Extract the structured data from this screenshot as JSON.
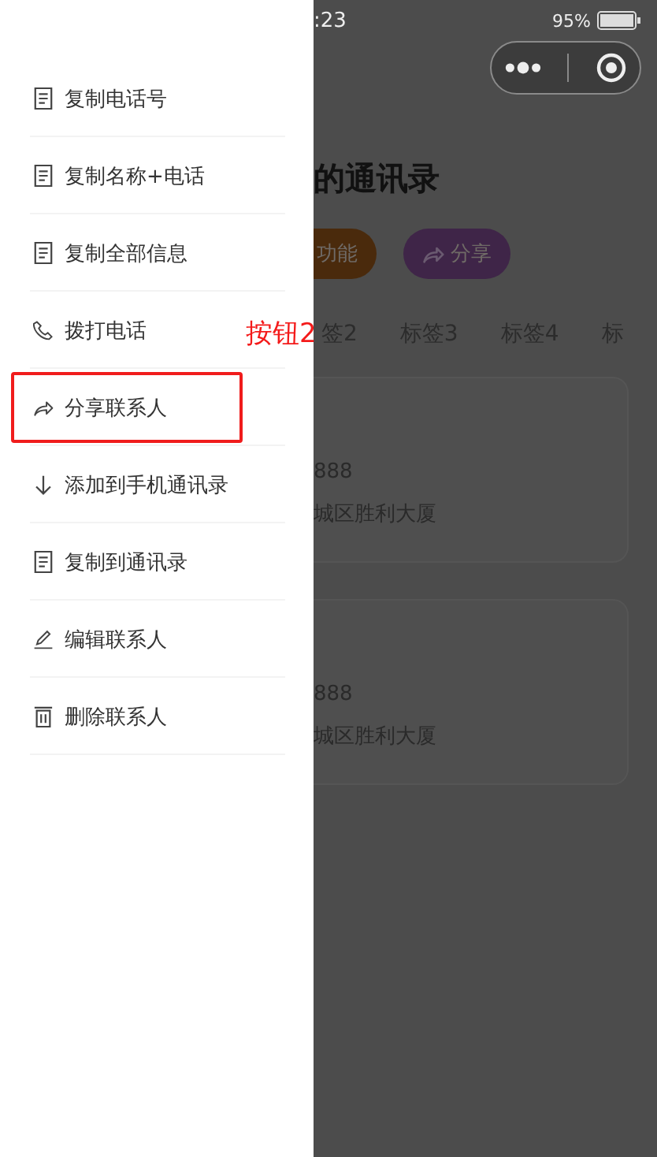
{
  "menu": {
    "items": [
      {
        "kind": "copy",
        "label": "复制电话号",
        "highlighted": false
      },
      {
        "kind": "copy",
        "label": "复制名称+电话",
        "highlighted": false
      },
      {
        "kind": "copy",
        "label": "复制全部信息",
        "highlighted": false
      },
      {
        "kind": "call",
        "label": "拨打电话",
        "highlighted": false
      },
      {
        "kind": "share",
        "label": "分享联系人",
        "highlighted": true
      },
      {
        "kind": "add",
        "label": "添加到手机通讯录",
        "highlighted": false
      },
      {
        "kind": "copy",
        "label": "复制到通讯录",
        "highlighted": false
      },
      {
        "kind": "edit",
        "label": "编辑联系人",
        "highlighted": false
      },
      {
        "kind": "delete",
        "label": "删除联系人",
        "highlighted": false
      }
    ]
  },
  "annotation": {
    "label": "按钮2"
  },
  "status_bar": {
    "time": ":23",
    "battery": "95%"
  },
  "page": {
    "title": "的通讯录",
    "buttons": [
      {
        "kind": "plain",
        "label": "功能",
        "color": "#4a2a0c"
      },
      {
        "kind": "share",
        "label": "分享",
        "color": "#3f2548"
      }
    ],
    "tabs": [
      "签2",
      "标签3",
      "标签4",
      "标"
    ],
    "cards": [
      {
        "phone": "888",
        "address": "城区胜利大厦"
      },
      {
        "phone": "888",
        "address": "城区胜利大厦"
      }
    ]
  }
}
